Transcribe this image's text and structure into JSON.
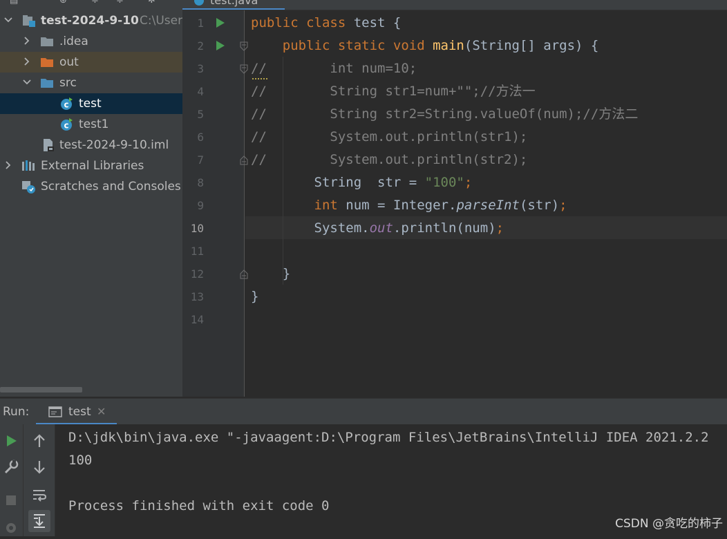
{
  "editor_tab": {
    "label": "test.java"
  },
  "project_tree": {
    "root": {
      "label": "test-2024-9-10",
      "path_hint": "C:\\Users"
    },
    "items": [
      {
        "label": ".idea"
      },
      {
        "label": "out"
      },
      {
        "label": "src"
      },
      {
        "label": "test"
      },
      {
        "label": "test1"
      },
      {
        "label": "test-2024-9-10.iml"
      },
      {
        "label": "External Libraries"
      },
      {
        "label": "Scratches and Consoles"
      }
    ]
  },
  "code": {
    "line_numbers": [
      "1",
      "2",
      "3",
      "4",
      "5",
      "6",
      "7",
      "8",
      "9",
      "10",
      "11",
      "12",
      "13",
      "14"
    ],
    "current_line": "10",
    "lines": [
      [
        {
          "t": "public class ",
          "c": "kw"
        },
        {
          "t": "test {",
          "c": ""
        }
      ],
      [
        {
          "t": "    public static void ",
          "c": "kw"
        },
        {
          "t": "main",
          "c": "fn"
        },
        {
          "t": "(String[] args) {",
          "c": ""
        }
      ],
      [
        {
          "t": "//        int num=10;",
          "c": "cmt"
        }
      ],
      [
        {
          "t": "//        String str1=num+\"\";//方法一",
          "c": "cmt"
        }
      ],
      [
        {
          "t": "//        String str2=String.valueOf(num);//方法二",
          "c": "cmt"
        }
      ],
      [
        {
          "t": "//        System.out.println(str1);",
          "c": "cmt"
        }
      ],
      [
        {
          "t": "//        System.out.println(str2);",
          "c": "cmt"
        }
      ],
      [
        {
          "t": "        String  str = ",
          "c": ""
        },
        {
          "t": "\"100\"",
          "c": "str"
        },
        {
          "t": ";",
          "c": "semi"
        }
      ],
      [
        {
          "t": "        int ",
          "c": "kw"
        },
        {
          "t": "num = Integer.",
          "c": ""
        },
        {
          "t": "parseInt",
          "c": "ital"
        },
        {
          "t": "(str)",
          "c": ""
        },
        {
          "t": ";",
          "c": "semi"
        }
      ],
      [
        {
          "t": "        System.",
          "c": ""
        },
        {
          "t": "out",
          "c": "fld"
        },
        {
          "t": ".println(num)",
          "c": ""
        },
        {
          "t": ";",
          "c": "semi"
        }
      ],
      [
        {
          "t": "",
          "c": ""
        }
      ],
      [
        {
          "t": "    }",
          "c": ""
        }
      ],
      [
        {
          "t": "}",
          "c": ""
        }
      ],
      [
        {
          "t": "",
          "c": ""
        }
      ]
    ]
  },
  "run_panel": {
    "label": "Run:",
    "tab_label": "test",
    "console_lines": [
      "D:\\jdk\\bin\\java.exe \"-javaagent:D:\\Program Files\\JetBrains\\IntelliJ IDEA 2021.2.2",
      "100",
      "",
      "Process finished with exit code 0"
    ]
  },
  "watermark": "CSDN @贪吃的柿子",
  "colors": {
    "keyword": "#cc7832",
    "method": "#ffc66d",
    "string": "#6a8759",
    "comment": "#808080",
    "field": "#9876aa",
    "accent": "#4a88c7",
    "run_green": "#499c54"
  },
  "icons": [
    "project-icon",
    "folder-icon",
    "java-class-icon",
    "run-icon",
    "rerun-icon",
    "wrench-icon",
    "stop-icon",
    "arrow-up-icon",
    "arrow-down-icon",
    "soft-wrap-icon",
    "scroll-to-end-icon",
    "close-icon",
    "console-tab-icon",
    "libraries-icon",
    "scratches-icon",
    "iml-file-icon",
    "fold-marker-icon"
  ]
}
